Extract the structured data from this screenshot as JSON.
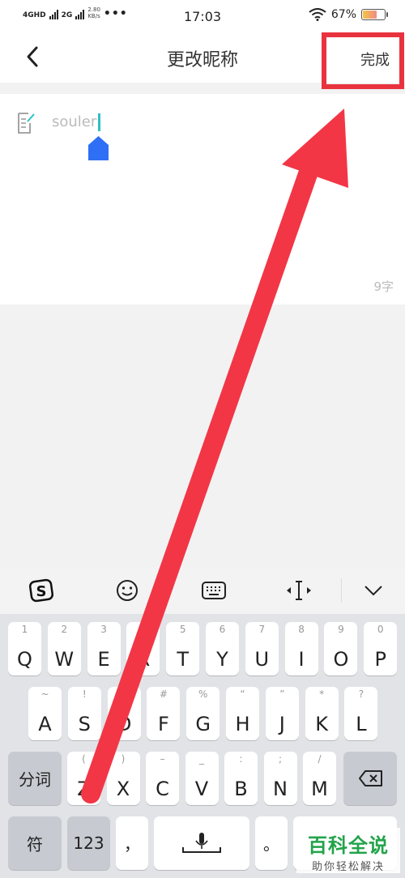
{
  "status_bar": {
    "network_1": "4GHD",
    "network_2": "2G",
    "speed_value": "2.80",
    "speed_unit": "KB/s",
    "more": "•••",
    "time": "17:03",
    "battery_percent": "67%",
    "battery_level": 0.67
  },
  "nav": {
    "title": "更改昵称",
    "done_label": "完成",
    "back_icon": "chevron-left-icon"
  },
  "editor": {
    "value": "souler",
    "char_count": "9字",
    "edit_icon": "edit-document-icon",
    "cursor_color": "#2cc0c6",
    "handle_color": "#2f6ff5"
  },
  "keyboard_toolbar": {
    "icons": [
      "sogou-logo-icon",
      "emoji-icon",
      "keyboard-icon",
      "cursor-move-icon",
      "chevron-down-icon"
    ]
  },
  "keyboard": {
    "row1": [
      {
        "sec": "1",
        "pri": "Q"
      },
      {
        "sec": "2",
        "pri": "W"
      },
      {
        "sec": "3",
        "pri": "E"
      },
      {
        "sec": "4",
        "pri": "R"
      },
      {
        "sec": "5",
        "pri": "T"
      },
      {
        "sec": "6",
        "pri": "Y"
      },
      {
        "sec": "7",
        "pri": "U"
      },
      {
        "sec": "8",
        "pri": "I"
      },
      {
        "sec": "9",
        "pri": "O"
      },
      {
        "sec": "0",
        "pri": "P"
      }
    ],
    "row2": [
      {
        "sec": "~",
        "pri": "A"
      },
      {
        "sec": "!",
        "pri": "S"
      },
      {
        "sec": "@",
        "pri": "D"
      },
      {
        "sec": "#",
        "pri": "F"
      },
      {
        "sec": "%",
        "pri": "G"
      },
      {
        "sec": "“",
        "pri": "H"
      },
      {
        "sec": "”",
        "pri": "J"
      },
      {
        "sec": "*",
        "pri": "K"
      },
      {
        "sec": "?",
        "pri": "L"
      }
    ],
    "row3_left": "分词",
    "row3": [
      {
        "sec": "(",
        "pri": "Z"
      },
      {
        "sec": ")",
        "pri": "X"
      },
      {
        "sec": "–",
        "pri": "C"
      },
      {
        "sec": "_",
        "pri": "V"
      },
      {
        "sec": ":",
        "pri": "B"
      },
      {
        "sec": ";",
        "pri": "N"
      },
      {
        "sec": "/",
        "pri": "M"
      }
    ],
    "symbol_key": "符",
    "number_key": "123",
    "comma_key": "，",
    "period_key": "。",
    "backspace_icon": "backspace-icon",
    "mic_icon": "microphone-icon",
    "accent_color": "#e8333f"
  },
  "watermark": {
    "title": "百科全说",
    "subtitle": "助你轻松解决"
  }
}
